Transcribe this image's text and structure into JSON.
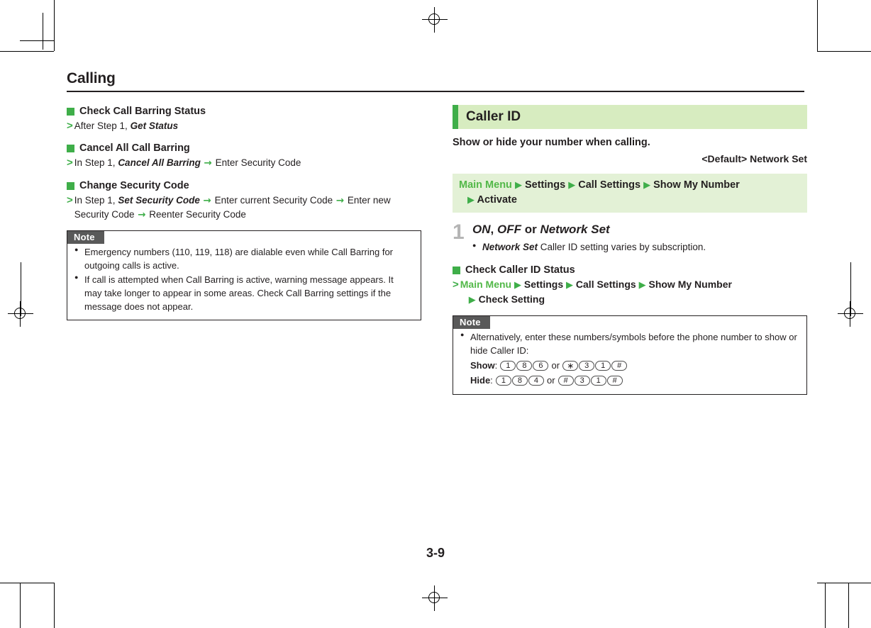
{
  "page": {
    "chapter_title": "Calling",
    "page_number": "3-9"
  },
  "accent_colors": {
    "green": "#3fae49",
    "green_text": "#52b848",
    "band_light_green": "#d7ecc0",
    "path_bar_green": "#e3f1d6",
    "note_label_gray": "#595959",
    "step_number_gray": "#b5b5b5",
    "text_black": "#231f20"
  },
  "left_column": {
    "blocks": [
      {
        "heading": "Check Call Barring Status",
        "procedure_parts": [
          {
            "text": "After Step 1, ",
            "style": "plain"
          },
          {
            "text": "Get Status",
            "style": "bold-italic"
          }
        ]
      },
      {
        "heading": "Cancel All Call Barring",
        "procedure_parts": [
          {
            "text": "In Step 1, ",
            "style": "plain"
          },
          {
            "text": "Cancel All Barring",
            "style": "bold-italic"
          },
          {
            "text": " → ",
            "style": "arrow"
          },
          {
            "text": "Enter Security Code",
            "style": "plain"
          }
        ]
      },
      {
        "heading": "Change Security Code",
        "procedure_parts": [
          {
            "text": "In Step 1, ",
            "style": "plain"
          },
          {
            "text": "Set Security Code",
            "style": "bold-italic"
          },
          {
            "text": " → ",
            "style": "arrow"
          },
          {
            "text": "Enter current Security Code",
            "style": "plain"
          },
          {
            "text": " → ",
            "style": "arrow"
          },
          {
            "text": "Enter new Security Code",
            "style": "plain"
          },
          {
            "text": " → ",
            "style": "arrow"
          },
          {
            "text": "Reenter Security Code",
            "style": "plain"
          }
        ]
      }
    ],
    "note": {
      "label": "Note",
      "items": [
        "Emergency numbers (110, 119, 118) are dialable even while Call Barring for outgoing calls is active.",
        "If call is attempted when Call Barring is active, warning message appears. It may take longer to appear in some areas. Check Call Barring settings if the message does not appear."
      ]
    }
  },
  "right_column": {
    "section": {
      "title": "Caller ID",
      "description": "Show or hide your number when calling.",
      "default_label": "<Default>",
      "default_value": "Network Set"
    },
    "menu_path": {
      "root": "Main Menu",
      "separator": "▶",
      "items": [
        "Settings",
        "Call Settings",
        "Show My Number",
        "Activate"
      ]
    },
    "step": {
      "number": "1",
      "options": [
        "ON",
        "OFF"
      ],
      "conjunction": "or",
      "option_last": "Network Set",
      "sub_bold": "Network Set",
      "sub_text": "Caller ID setting varies by subscription."
    },
    "check_status": {
      "heading": "Check Caller ID Status",
      "path_root": "Main Menu",
      "path_items": [
        "Settings",
        "Call Settings",
        "Show My Number",
        "Check Setting"
      ]
    },
    "note": {
      "label": "Note",
      "intro": "Alternatively, enter these numbers/symbols before the phone number to show or hide Caller ID:",
      "rows": [
        {
          "label": "Show",
          "keys_a": [
            "1",
            "8",
            "6"
          ],
          "joiner": "or",
          "keys_b": [
            "∗",
            "3",
            "1",
            "#"
          ]
        },
        {
          "label": "Hide",
          "keys_a": [
            "1",
            "8",
            "4"
          ],
          "joiner": "or",
          "keys_b": [
            "#",
            "3",
            "1",
            "#"
          ]
        }
      ]
    }
  }
}
